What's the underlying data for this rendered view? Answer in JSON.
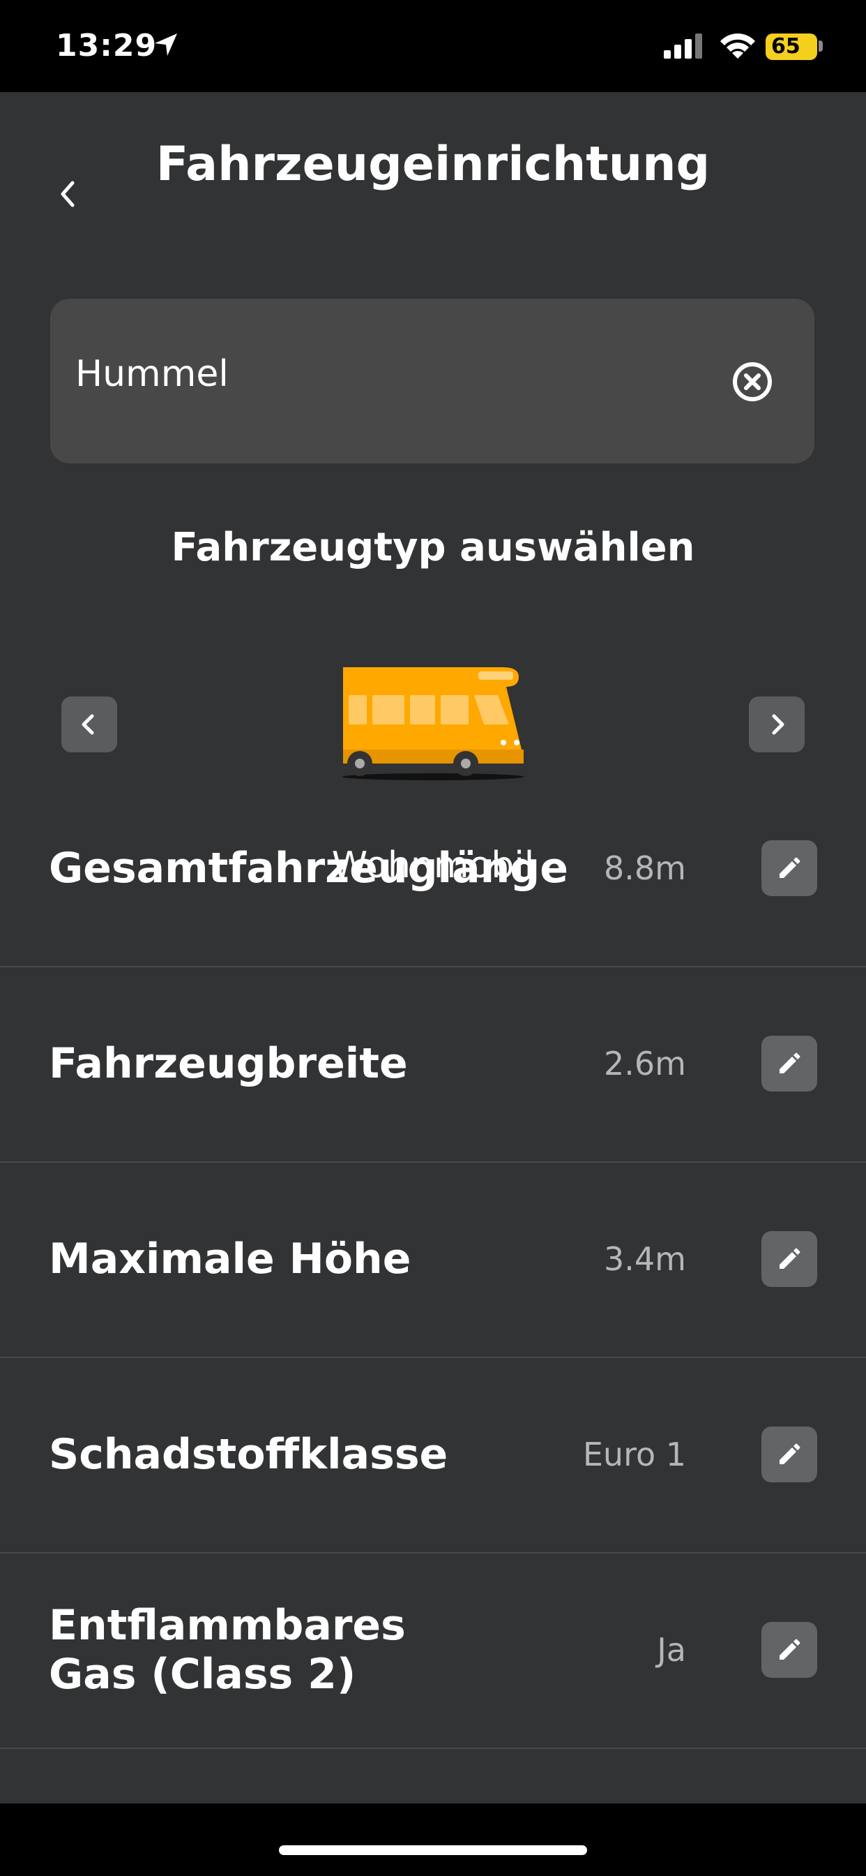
{
  "status_bar": {
    "time": "13:29",
    "battery": "65"
  },
  "header": {
    "title": "Fahrzeugeinrichtung"
  },
  "name_field": {
    "value": "Hummel"
  },
  "vehicle_selector": {
    "title": "Fahrzeugtyp auswählen",
    "selected_label": "Wohnmobil",
    "accent_color": "#FFA800"
  },
  "settings": [
    {
      "label": "Gesamtfahrzeuglänge",
      "value": "8.8m"
    },
    {
      "label": "Fahrzeugbreite",
      "value": "2.6m"
    },
    {
      "label": "Maximale Höhe",
      "value": "3.4m"
    },
    {
      "label": "Schadstoffklasse",
      "value": "Euro 1"
    },
    {
      "label": "Entflammbares Gas (Class 2)",
      "value": "Ja"
    }
  ]
}
